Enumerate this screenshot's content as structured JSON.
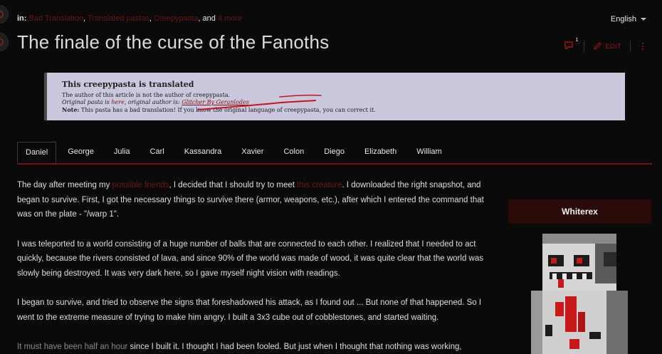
{
  "header": {
    "categories_prefix": "in:",
    "categories": [
      "Bad Translation",
      "Translated pastas",
      "Creepypasta"
    ],
    "categories_more_join": ", and ",
    "categories_more": "4 more",
    "language": "English"
  },
  "page": {
    "title": "The finale of the curse of the Fanoths",
    "comment_count": "1",
    "edit_label": "EDIT"
  },
  "notice": {
    "heading": "This creepypasta is translated",
    "line1": "The author of this article is not the author of creepypasta.",
    "line2_prefix": "Original pasta is ",
    "line2_link": "here",
    "line2_mid": ", original author is: ",
    "line2_author": "Glitcher By Geranlodes",
    "line3_label": "Note:",
    "line3_text": " This pasta has a bad translation! If you know the original language of creepypasta, you can correct it."
  },
  "tabs": [
    "Daniel",
    "George",
    "Julia",
    "Carl",
    "Kassandra",
    "Xavier",
    "Colon",
    "Diego",
    "Elizabeth",
    "William"
  ],
  "active_tab": "Daniel",
  "article": {
    "p1_a": "The day after meeting my ",
    "p1_link1": "possible friends",
    "p1_b": ", I decided that I should try to meet ",
    "p1_link2": "this creature",
    "p1_c": ". I downloaded the right snapshot, and began to survive. First, I got the necessary things to survive there (armor, weapons, etc.), after which I entered the command that was on the plate - \"/warp 1\".",
    "p2": "I was teleported to a world consisting of a huge number of balls that are connected to each other. I realized that I needed to act quickly, because the rivers consisted of lava, and since 90% of the world was made of wood, it was quite clear that the world was slowly being destroyed. It was very dark here, so I gave myself night vision with readings.",
    "p3": "I began to survive, and tried to observe the signs that foreshadowed his attack, as I found out ... But none of that happened. So I went to the extreme measure of trying to make him angry. I built a 3x3 cube out of cobblestones, and started waiting.",
    "p4_a": "It must have been half an hour",
    "p4_b": " since I built it. I thought I had been fooled. But just when I thought that nothing was working,"
  },
  "infobox": {
    "title": "Whiterex",
    "image_icon": "pixel-character-portrait"
  },
  "colors": {
    "background": "#0a0a0a",
    "accent_red": "#6e1313",
    "link_red": "#6c1717",
    "notice_bg": "#c9c8dd",
    "infobox_header": "#2a0909"
  }
}
